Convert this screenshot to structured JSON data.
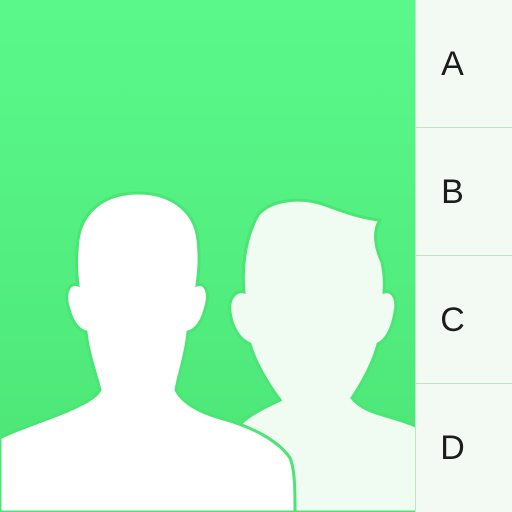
{
  "icon": {
    "subject": "contacts-app-icon",
    "colors": {
      "background_top": "#5af88b",
      "background_bottom": "#4be575",
      "front_silhouette": "#ffffff",
      "back_silhouette": "#f0fbf1",
      "index_background": "#f2faf3",
      "index_divider": "#bde6c6",
      "letter_color": "#1c1c1c"
    }
  },
  "index_tabs": [
    {
      "letter": "A"
    },
    {
      "letter": "B"
    },
    {
      "letter": "C"
    },
    {
      "letter": "D"
    }
  ]
}
